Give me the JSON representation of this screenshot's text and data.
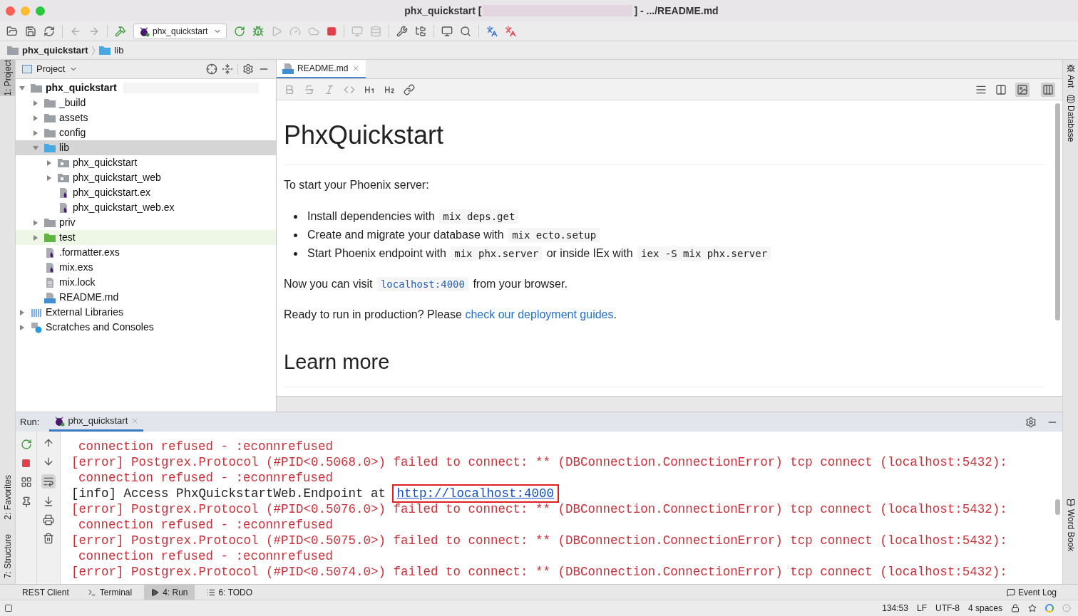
{
  "window": {
    "title_start": "phx_quickstart [",
    "title_end": "] - .../README.md"
  },
  "toolbar": {
    "run_config": "phx_quickstart"
  },
  "breadcrumb": [
    "phx_quickstart",
    "lib"
  ],
  "left_strip_top": [
    {
      "label": "1: Project",
      "selected": true
    }
  ],
  "left_strip_bottom": [
    {
      "label": "2: Favorites",
      "selected": false
    },
    {
      "label": "7: Structure",
      "selected": false
    }
  ],
  "right_strip_top": [
    {
      "label": "Ant"
    },
    {
      "label": "Database"
    }
  ],
  "right_strip_bottom": [
    {
      "label": "Word Book"
    }
  ],
  "project_panel": {
    "title": "Project",
    "tree": [
      {
        "label": "phx_quickstart",
        "kind": "project",
        "expanded": true,
        "selected": false,
        "children": [
          {
            "label": "_build",
            "kind": "folder",
            "expanded": false,
            "selected": false
          },
          {
            "label": "assets",
            "kind": "folder",
            "expanded": false,
            "selected": false
          },
          {
            "label": "config",
            "kind": "folder",
            "expanded": false,
            "selected": false
          },
          {
            "label": "lib",
            "kind": "source",
            "expanded": true,
            "selected": true,
            "children": [
              {
                "label": "phx_quickstart",
                "kind": "package",
                "expanded": false,
                "selected": false
              },
              {
                "label": "phx_quickstart_web",
                "kind": "package",
                "expanded": false,
                "selected": false
              },
              {
                "label": "phx_quickstart.ex",
                "kind": "elixir",
                "selected": false
              },
              {
                "label": "phx_quickstart_web.ex",
                "kind": "elixir",
                "selected": false
              }
            ]
          },
          {
            "label": "priv",
            "kind": "folder",
            "expanded": false,
            "selected": false
          },
          {
            "label": "test",
            "kind": "test",
            "expanded": false,
            "selected": false
          },
          {
            "label": ".formatter.exs",
            "kind": "elixir",
            "selected": false
          },
          {
            "label": "mix.exs",
            "kind": "elixir",
            "selected": false
          },
          {
            "label": "mix.lock",
            "kind": "text",
            "selected": false
          },
          {
            "label": "README.md",
            "kind": "markdown",
            "selected": false
          }
        ]
      },
      {
        "label": "External Libraries",
        "kind": "libraries",
        "expanded": false,
        "selected": false
      },
      {
        "label": "Scratches and Consoles",
        "kind": "scratches",
        "expanded": false,
        "selected": false
      }
    ]
  },
  "editor": {
    "tabs": [
      {
        "label": "README.md",
        "selected": true
      }
    ],
    "blocks": [
      {
        "kind": "h1",
        "text": "PhxQuickstart"
      },
      {
        "kind": "p",
        "parts": [
          {
            "kind": "text",
            "text": "To start your Phoenix server:"
          }
        ]
      },
      {
        "kind": "ul",
        "items": [
          {
            "parts": [
              {
                "kind": "text",
                "text": "Install dependencies with "
              },
              {
                "kind": "code",
                "text": "mix deps.get"
              }
            ]
          },
          {
            "parts": [
              {
                "kind": "text",
                "text": "Create and migrate your database with "
              },
              {
                "kind": "code",
                "text": "mix ecto.setup"
              }
            ]
          },
          {
            "parts": [
              {
                "kind": "text",
                "text": "Start Phoenix endpoint with "
              },
              {
                "kind": "code",
                "text": "mix phx.server"
              },
              {
                "kind": "text",
                "text": " or inside IEx with "
              },
              {
                "kind": "code",
                "text": "iex -S mix phx.server"
              }
            ]
          }
        ]
      },
      {
        "kind": "p",
        "parts": [
          {
            "kind": "text",
            "text": "Now you can visit "
          },
          {
            "kind": "code_link",
            "text": "localhost:4000"
          },
          {
            "kind": "text",
            "text": " from your browser."
          }
        ]
      },
      {
        "kind": "p",
        "parts": [
          {
            "kind": "text",
            "text": "Ready to run in production? Please "
          },
          {
            "kind": "link",
            "text": "check our deployment guides"
          },
          {
            "kind": "text",
            "text": "."
          }
        ]
      },
      {
        "kind": "h2",
        "text": "Learn more"
      }
    ]
  },
  "run": {
    "label": "Run:",
    "tabs": [
      {
        "label": "phx_quickstart",
        "selected": true
      }
    ],
    "lines": [
      {
        "kind": "continuation",
        "text": "connection refused - :econnrefused"
      },
      {
        "kind": "error",
        "text": "[error] Postgrex.Protocol (#PID<0.5068.0>) failed to connect: ** (DBConnection.ConnectionError) tcp connect (localhost:5432):"
      },
      {
        "kind": "continuation",
        "text": "connection refused - :econnrefused"
      },
      {
        "kind": "info",
        "text": "[info] Access PhxQuickstartWeb.Endpoint at ",
        "link": "http://localhost:4000",
        "highlighted": true
      },
      {
        "kind": "error",
        "text": "[error] Postgrex.Protocol (#PID<0.5076.0>) failed to connect: ** (DBConnection.ConnectionError) tcp connect (localhost:5432):"
      },
      {
        "kind": "continuation",
        "text": "connection refused - :econnrefused"
      },
      {
        "kind": "error",
        "text": "[error] Postgrex.Protocol (#PID<0.5075.0>) failed to connect: ** (DBConnection.ConnectionError) tcp connect (localhost:5432):"
      },
      {
        "kind": "continuation",
        "text": "connection refused - :econnrefused"
      },
      {
        "kind": "error",
        "text": "[error] Postgrex.Protocol (#PID<0.5074.0>) failed to connect: ** (DBConnection.ConnectionError) tcp connect (localhost:5432):"
      }
    ]
  },
  "tool_tabs": [
    {
      "label": "REST Client",
      "kind": "plain",
      "selected": false
    },
    {
      "label": "Terminal",
      "kind": "terminal",
      "selected": false
    },
    {
      "label": "4: Run",
      "kind": "run",
      "selected": true
    },
    {
      "label": "6: TODO",
      "kind": "todo",
      "selected": false
    }
  ],
  "event_log": "Event Log",
  "status": [
    "134:53",
    "LF",
    "UTF-8",
    "4 spaces"
  ]
}
